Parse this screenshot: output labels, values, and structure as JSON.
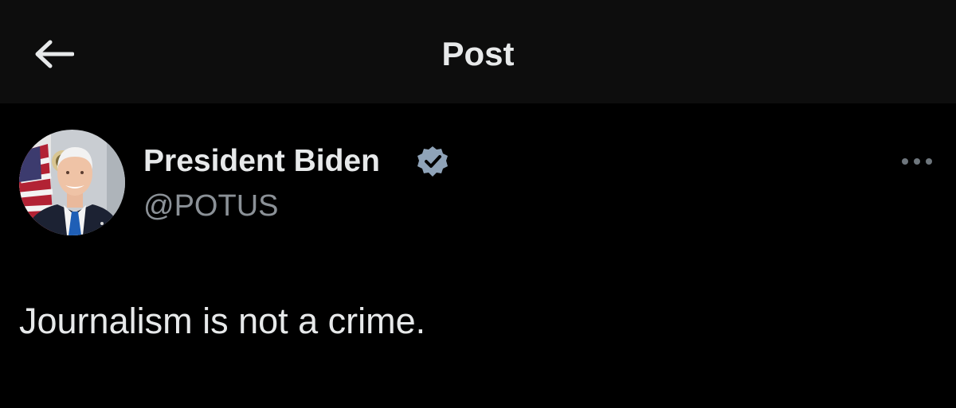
{
  "header": {
    "back_icon": "arrow-left-icon",
    "title": "Post"
  },
  "post": {
    "author": {
      "display_name": "President Biden",
      "handle": "@POTUS",
      "verified_icon": "verified-badge-icon",
      "avatar": "avatar-portrait"
    },
    "more_icon": "more-horizontal-icon",
    "text": "Journalism is not a crime."
  },
  "colors": {
    "background": "#000000",
    "header_background": "#0d0d0d",
    "primary_text": "#e7e9ea",
    "secondary_text": "#8b9197",
    "verified_badge": "#8fa3b8"
  }
}
